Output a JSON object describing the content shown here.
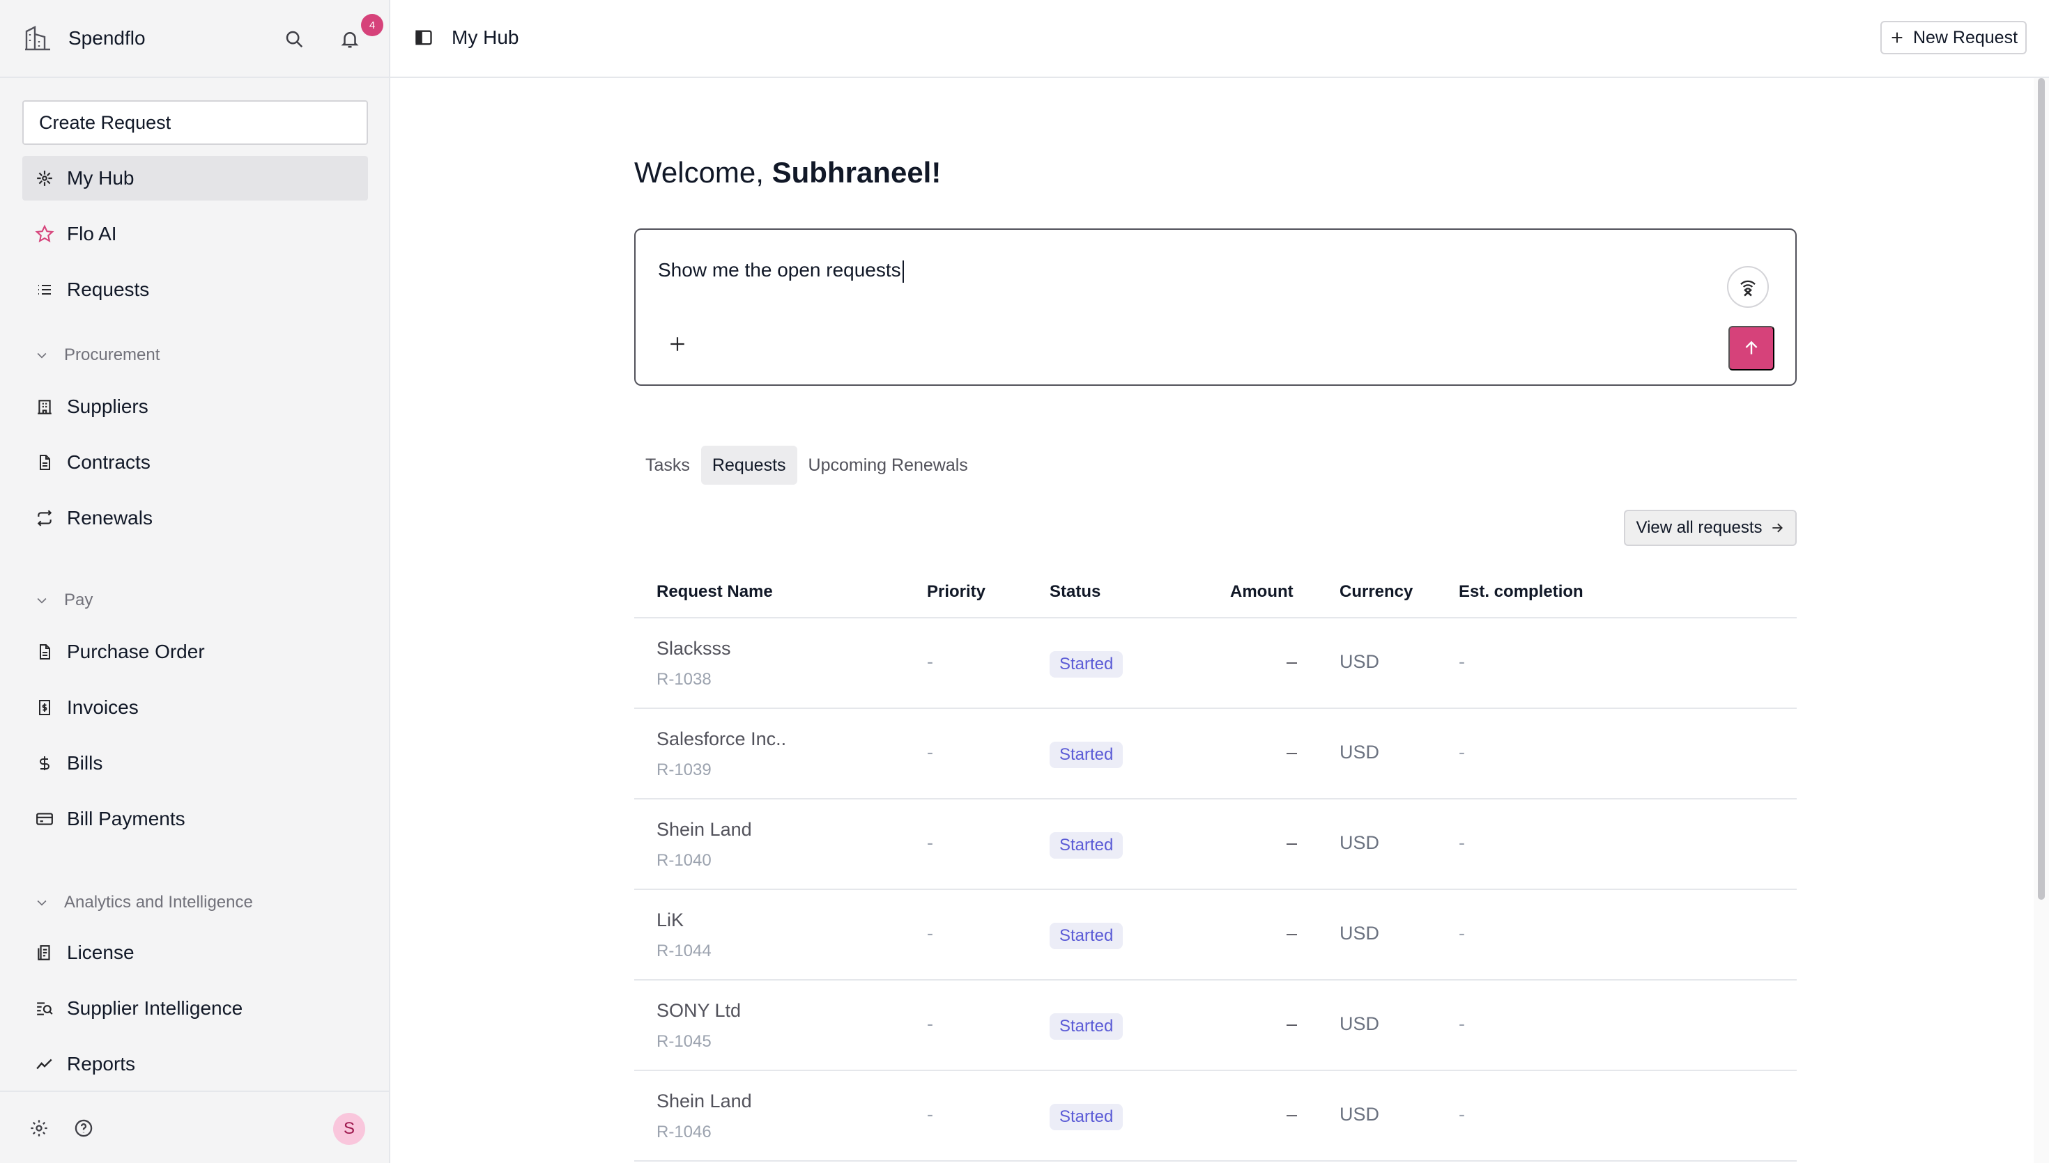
{
  "sidebar": {
    "brand": "Spendflo",
    "notification_count": "4",
    "create_request": "Create Request",
    "items_top": [
      {
        "label": "My Hub",
        "icon": "hub-icon"
      },
      {
        "label": "Flo AI",
        "icon": "star-icon"
      },
      {
        "label": "Requests",
        "icon": "list-icon"
      }
    ],
    "sections": [
      {
        "label": "Procurement",
        "items": [
          {
            "label": "Suppliers",
            "icon": "building-icon"
          },
          {
            "label": "Contracts",
            "icon": "document-icon"
          },
          {
            "label": "Renewals",
            "icon": "renew-icon"
          }
        ]
      },
      {
        "label": "Pay",
        "items": [
          {
            "label": "Purchase Order",
            "icon": "document-icon"
          },
          {
            "label": "Invoices",
            "icon": "invoice-icon"
          },
          {
            "label": "Bills",
            "icon": "dollar-icon"
          },
          {
            "label": "Bill Payments",
            "icon": "card-icon"
          }
        ]
      },
      {
        "label": "Analytics and Intelligence",
        "items": [
          {
            "label": "License",
            "icon": "license-icon"
          },
          {
            "label": "Supplier Intelligence",
            "icon": "search-list-icon"
          },
          {
            "label": "Reports",
            "icon": "trend-icon"
          }
        ]
      }
    ],
    "avatar_initial": "S"
  },
  "topbar": {
    "title": "My Hub",
    "new_request": "New Request"
  },
  "main": {
    "welcome_prefix": "Welcome, ",
    "welcome_name": "Subhraneel!",
    "prompt_value": "Show me the open requests",
    "tabs": [
      "Tasks",
      "Requests",
      "Upcoming Renewals"
    ],
    "active_tab": "Requests",
    "view_all": "View all requests"
  },
  "table": {
    "headers": [
      "Request Name",
      "Priority",
      "Status",
      "Amount",
      "Currency",
      "Est. completion"
    ],
    "rows": [
      {
        "name": "Slacksss",
        "id": "R-1038",
        "priority": "-",
        "status": "Started",
        "amount": "–",
        "currency": "USD",
        "est": "-"
      },
      {
        "name": "Salesforce Inc..",
        "id": "R-1039",
        "priority": "-",
        "status": "Started",
        "amount": "–",
        "currency": "USD",
        "est": "-"
      },
      {
        "name": "Shein Land",
        "id": "R-1040",
        "priority": "-",
        "status": "Started",
        "amount": "–",
        "currency": "USD",
        "est": "-"
      },
      {
        "name": "LiK",
        "id": "R-1044",
        "priority": "-",
        "status": "Started",
        "amount": "–",
        "currency": "USD",
        "est": "-"
      },
      {
        "name": "SONY Ltd",
        "id": "R-1045",
        "priority": "-",
        "status": "Started",
        "amount": "–",
        "currency": "USD",
        "est": "-"
      },
      {
        "name": "Shein Land",
        "id": "R-1046",
        "priority": "-",
        "status": "Started",
        "amount": "–",
        "currency": "USD",
        "est": "-"
      }
    ]
  },
  "colors": {
    "accent": "#d6427a",
    "status_text": "#5b5bd6",
    "status_bg": "#ecedf7"
  }
}
